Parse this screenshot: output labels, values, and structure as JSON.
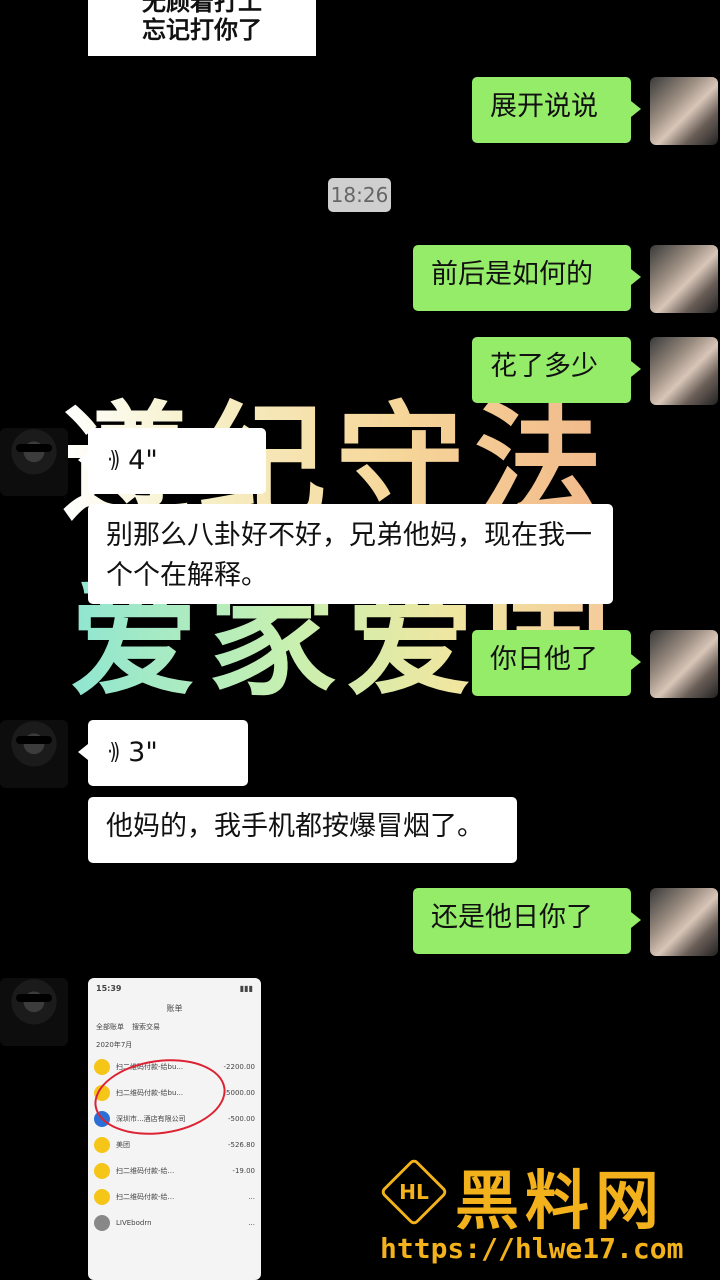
{
  "background_text": {
    "line1": "遵纪守法",
    "line2": "爱家爱国"
  },
  "top_card": {
    "line1": "无顾着打工",
    "line2": "忘记打你了"
  },
  "timestamp": "18:26",
  "messages": [
    {
      "sender": "me",
      "text": "展开说说"
    },
    {
      "sender": "me",
      "text": "前后是如何的"
    },
    {
      "sender": "me",
      "text": "花了多少"
    },
    {
      "sender": "them",
      "type": "voice",
      "duration": "4\""
    },
    {
      "sender": "them",
      "text": "别那么八卦好不好，兄弟他妈，现在我一个个在解释。"
    },
    {
      "sender": "me",
      "text": "你日他了"
    },
    {
      "sender": "them",
      "type": "voice",
      "duration": "3\""
    },
    {
      "sender": "them",
      "text": "他妈的，我手机都按爆冒烟了。"
    },
    {
      "sender": "me",
      "text": "还是他日你了"
    }
  ],
  "voice_icon": "voice-wave-icon",
  "screenshot": {
    "status_time": "15:39",
    "title": "账单",
    "filter1": "全部账单",
    "filter2": "搜索交易",
    "month": "2020年7月",
    "rows": [
      {
        "name": "扫二维码付款-给bu...",
        "amount": "-2200.00"
      },
      {
        "name": "扫二维码付款-给bu...",
        "amount": "-5000.00"
      },
      {
        "name": "深圳市...酒店有限公司",
        "amount": "-500.00"
      },
      {
        "name": "美团",
        "amount": "-526.80"
      },
      {
        "name": "扫二维码付款-给...",
        "amount": "-19.00"
      },
      {
        "name": "扫二维码付款-给...",
        "amount": "..."
      },
      {
        "name": "LIVEbodrn",
        "amount": "..."
      }
    ]
  },
  "watermark": {
    "logo": "HL",
    "brand": "黑料网",
    "url": "https://hlwe17.com"
  },
  "colors": {
    "me_bubble": "#95ec69",
    "them_bubble": "#ffffff",
    "watermark": "#f3b21b"
  }
}
